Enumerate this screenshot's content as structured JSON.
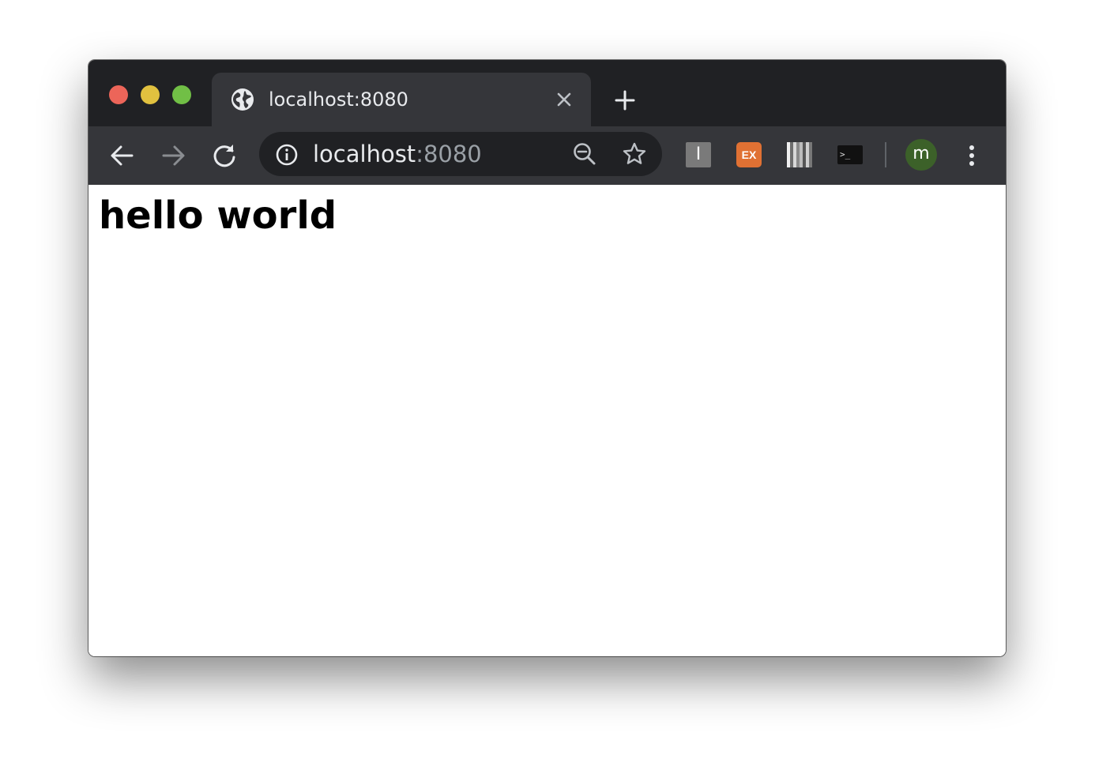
{
  "window": {
    "traffic_lights": {
      "close_color": "#ec6559",
      "minimize_color": "#e1c13f",
      "maximize_color": "#71bf46"
    }
  },
  "tab": {
    "title": "localhost:8080",
    "favicon": "globe-icon",
    "close_icon": "close-icon"
  },
  "tabstrip": {
    "new_tab_icon": "plus-icon"
  },
  "toolbar": {
    "back_icon": "back-arrow-icon",
    "forward_icon": "forward-arrow-icon",
    "forward_enabled": false,
    "reload_icon": "reload-icon",
    "omnibox": {
      "security_icon": "info-icon",
      "url_host": "localhost",
      "url_port": ":8080",
      "zoom_icon": "zoom-out-icon",
      "bookmark_icon": "star-icon"
    },
    "extensions": [
      {
        "name": "extension-i",
        "label": "I",
        "color": "#7a7a7a"
      },
      {
        "name": "extension-ex",
        "label": "EX",
        "color": "#e07133"
      },
      {
        "name": "extension-bars",
        "label": "",
        "color": "#9a9a9a"
      },
      {
        "name": "extension-terminal",
        "label": ">_",
        "color": "#111111"
      }
    ],
    "avatar": {
      "label": "m",
      "color": "#3c6129"
    },
    "menu_icon": "kebab-menu-icon"
  },
  "page": {
    "heading": "hello world"
  },
  "colors": {
    "tabstrip_bg": "#202124",
    "toolbar_bg": "#35363a",
    "omnibox_bg": "#202124",
    "text_primary": "#e8eaed",
    "text_muted": "#9aa0a6"
  }
}
